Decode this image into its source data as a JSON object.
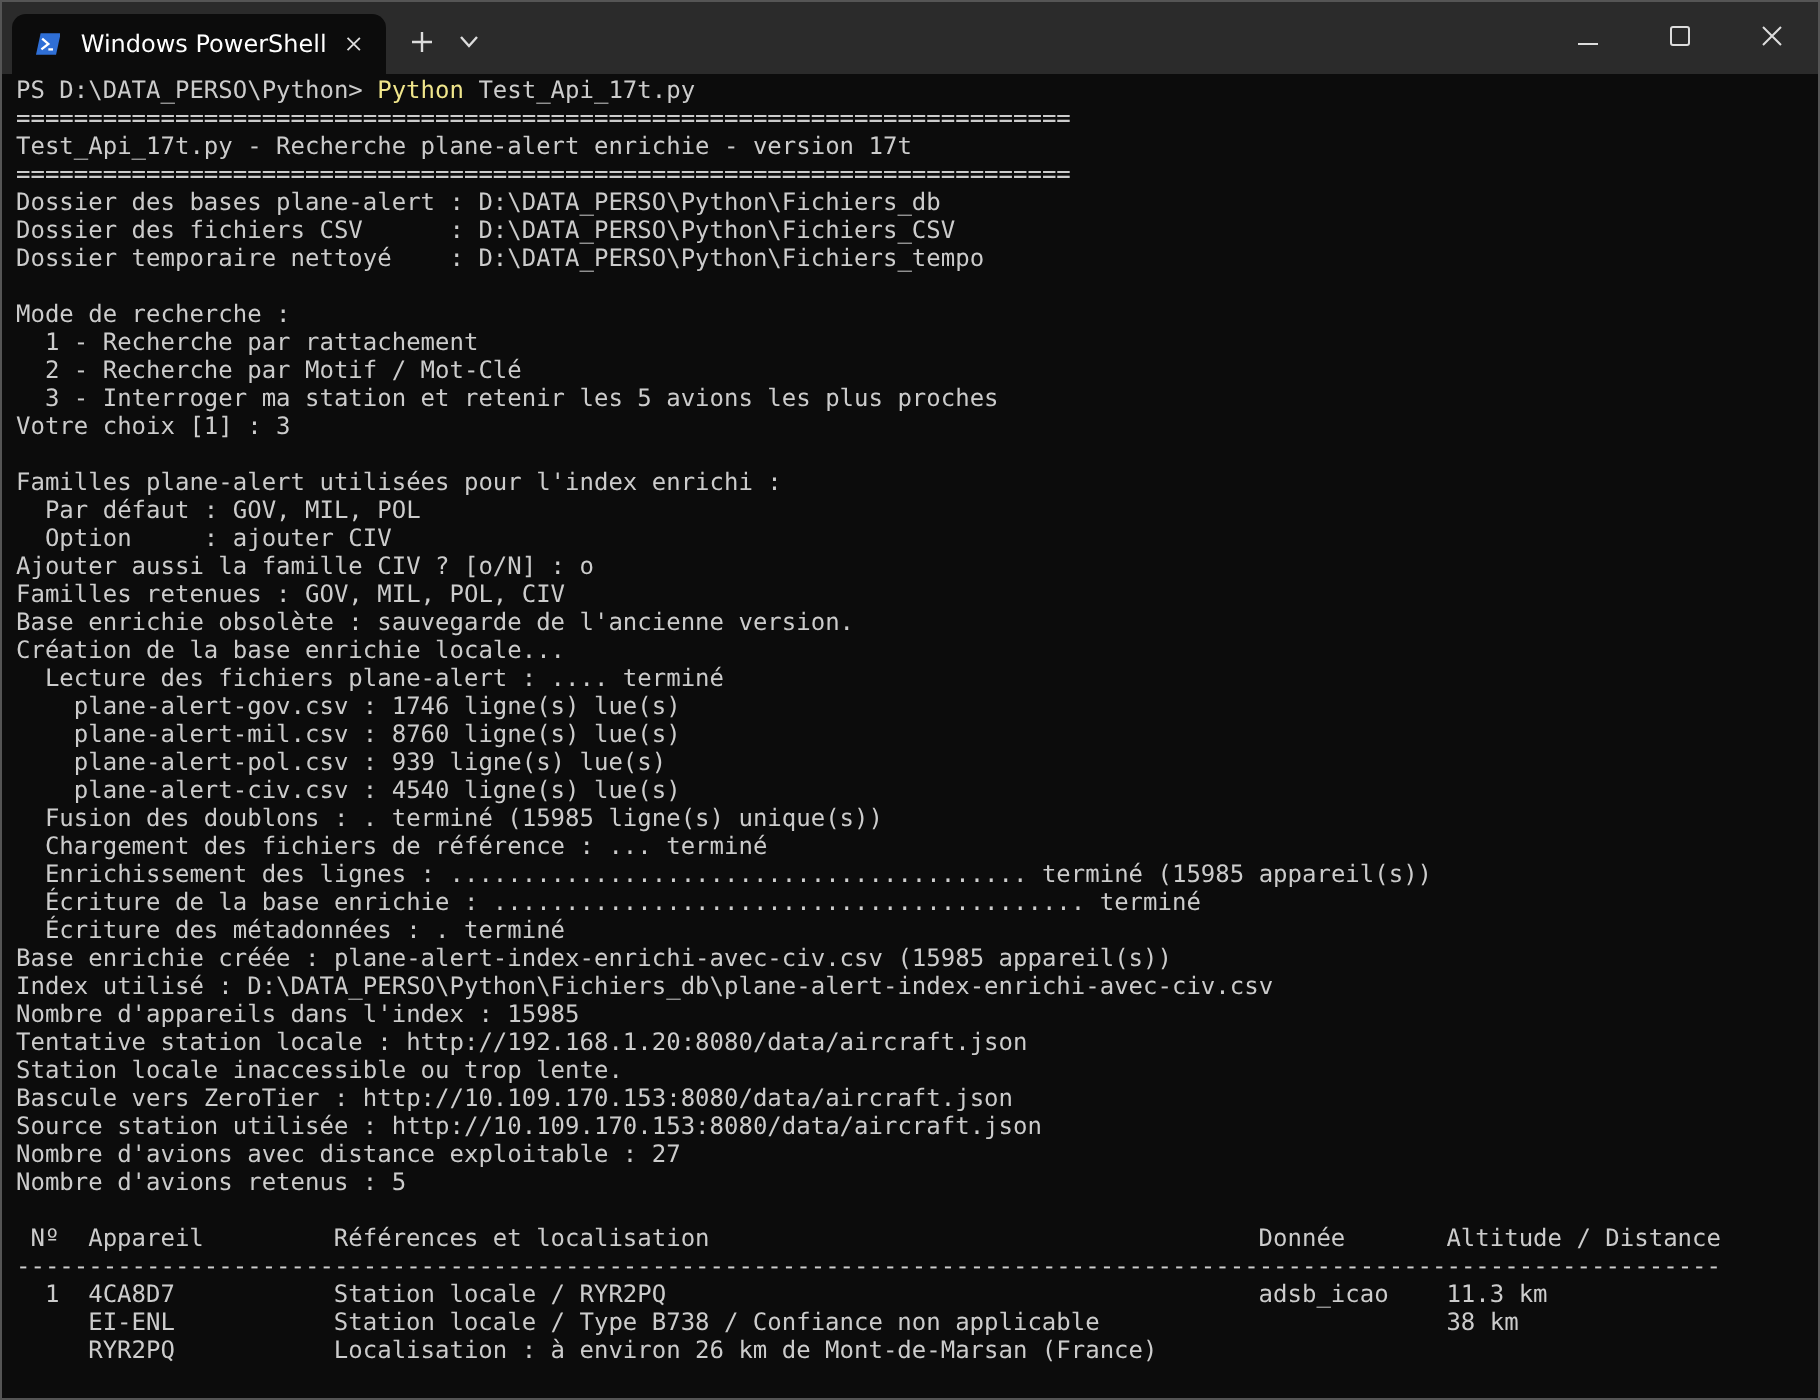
{
  "window": {
    "tab_title": "Windows PowerShell"
  },
  "prompt": {
    "prompt": "PS D:\\DATA_PERSO\\Python>",
    "command": "Python",
    "args": "Test_Api_17t.py"
  },
  "lines": [
    {
      "kind": "text",
      "text": "========================================================================="
    },
    {
      "kind": "text",
      "text": "Test_Api_17t.py - Recherche plane-alert enrichie - version 17t"
    },
    {
      "kind": "text",
      "text": "========================================================================="
    },
    {
      "kind": "text",
      "text": "Dossier des bases plane-alert : D:\\DATA_PERSO\\Python\\Fichiers_db"
    },
    {
      "kind": "text",
      "text": "Dossier des fichiers CSV      : D:\\DATA_PERSO\\Python\\Fichiers_CSV"
    },
    {
      "kind": "text",
      "text": "Dossier temporaire nettoyé    : D:\\DATA_PERSO\\Python\\Fichiers_tempo"
    },
    {
      "kind": "blank"
    },
    {
      "kind": "text",
      "text": "Mode de recherche :"
    },
    {
      "kind": "text",
      "text": "  1 - Recherche par rattachement"
    },
    {
      "kind": "text",
      "text": "  2 - Recherche par Motif / Mot-Clé"
    },
    {
      "kind": "text",
      "text": "  3 - Interroger ma station et retenir les 5 avions les plus proches"
    },
    {
      "kind": "text",
      "text": "Votre choix [1] : 3"
    },
    {
      "kind": "blank"
    },
    {
      "kind": "text",
      "text": "Familles plane-alert utilisées pour l'index enrichi :"
    },
    {
      "kind": "text",
      "text": "  Par défaut : GOV, MIL, POL"
    },
    {
      "kind": "text",
      "text": "  Option     : ajouter CIV"
    },
    {
      "kind": "text",
      "text": "Ajouter aussi la famille CIV ? [o/N] : o"
    },
    {
      "kind": "text",
      "text": "Familles retenues : GOV, MIL, POL, CIV"
    },
    {
      "kind": "text",
      "text": "Base enrichie obsolète : sauvegarde de l'ancienne version."
    },
    {
      "kind": "text",
      "text": "Création de la base enrichie locale..."
    },
    {
      "kind": "text",
      "text": "  Lecture des fichiers plane-alert : .... terminé"
    },
    {
      "kind": "text",
      "text": "    plane-alert-gov.csv : 1746 ligne(s) lue(s)"
    },
    {
      "kind": "text",
      "text": "    plane-alert-mil.csv : 8760 ligne(s) lue(s)"
    },
    {
      "kind": "text",
      "text": "    plane-alert-pol.csv : 939 ligne(s) lue(s)"
    },
    {
      "kind": "text",
      "text": "    plane-alert-civ.csv : 4540 ligne(s) lue(s)"
    },
    {
      "kind": "text",
      "text": "  Fusion des doublons : . terminé (15985 ligne(s) unique(s))"
    },
    {
      "kind": "text",
      "text": "  Chargement des fichiers de référence : ... terminé"
    },
    {
      "kind": "text",
      "text": "  Enrichissement des lignes : ........................................ terminé (15985 appareil(s))"
    },
    {
      "kind": "text",
      "text": "  Écriture de la base enrichie : ......................................... terminé"
    },
    {
      "kind": "text",
      "text": "  Écriture des métadonnées : . terminé"
    },
    {
      "kind": "text",
      "text": "Base enrichie créée : plane-alert-index-enrichi-avec-civ.csv (15985 appareil(s))"
    },
    {
      "kind": "text",
      "text": "Index utilisé : D:\\DATA_PERSO\\Python\\Fichiers_db\\plane-alert-index-enrichi-avec-civ.csv"
    },
    {
      "kind": "text",
      "text": "Nombre d'appareils dans l'index : 15985"
    },
    {
      "kind": "text",
      "text": "Tentative station locale : http://192.168.1.20:8080/data/aircraft.json"
    },
    {
      "kind": "text",
      "text": "Station locale inaccessible ou trop lente."
    },
    {
      "kind": "text",
      "text": "Bascule vers ZeroTier : http://10.109.170.153:8080/data/aircraft.json"
    },
    {
      "kind": "text",
      "text": "Source station utilisée : http://10.109.170.153:8080/data/aircraft.json"
    },
    {
      "kind": "text",
      "text": "Nombre d'avions avec distance exploitable : 27"
    },
    {
      "kind": "text",
      "text": "Nombre d'avions retenus : 5"
    },
    {
      "kind": "blank"
    }
  ],
  "table": {
    "columns": [
      "Nº",
      "Appareil",
      "Références et localisation",
      "Donnée",
      "Altitude / Distance"
    ],
    "separator": "----------------------------------------------------------------------------------------------------------------------",
    "rows": [
      {
        "number": "1",
        "appareil": [
          "4CA8D7",
          "EI-ENL",
          "RYR2PQ"
        ],
        "references": [
          "Station locale / RYR2PQ",
          "Station locale / Type B738 / Confiance non applicable",
          "Localisation : à environ 26 km de Mont-de-Marsan (France)"
        ],
        "donnee": [
          "adsb_icao"
        ],
        "altitude": [
          "11.3 km",
          "38 km"
        ]
      }
    ]
  }
}
